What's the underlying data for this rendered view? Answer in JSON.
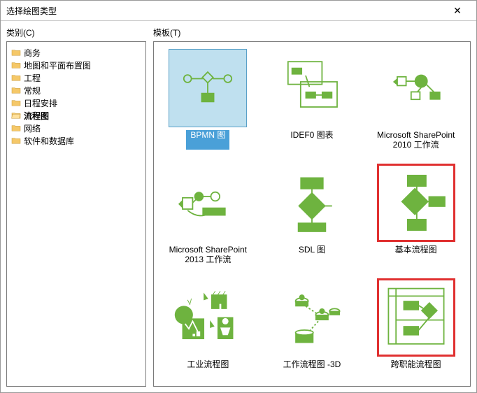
{
  "titlebar": {
    "title": "选择绘图类型",
    "close_label": "✕"
  },
  "left": {
    "label": "类别(C)",
    "items": [
      {
        "label": "商务",
        "selected": false
      },
      {
        "label": "地图和平面布置图",
        "selected": false
      },
      {
        "label": "工程",
        "selected": false
      },
      {
        "label": "常规",
        "selected": false
      },
      {
        "label": "日程安排",
        "selected": false
      },
      {
        "label": "流程图",
        "selected": true
      },
      {
        "label": "网络",
        "selected": false
      },
      {
        "label": "软件和数据库",
        "selected": false
      }
    ]
  },
  "right": {
    "label": "模板(T)",
    "templates": [
      {
        "label": "BPMN 图",
        "selected": true,
        "highlight": false
      },
      {
        "label": "IDEF0 图表",
        "selected": false,
        "highlight": false
      },
      {
        "label": "Microsoft SharePoint 2010 工作流",
        "selected": false,
        "highlight": false
      },
      {
        "label": "Microsoft SharePoint 2013 工作流",
        "selected": false,
        "highlight": false
      },
      {
        "label": "SDL 图",
        "selected": false,
        "highlight": false
      },
      {
        "label": "基本流程图",
        "selected": false,
        "highlight": true
      },
      {
        "label": "工业流程图",
        "selected": false,
        "highlight": false
      },
      {
        "label": "工作流程图 -3D",
        "selected": false,
        "highlight": false
      },
      {
        "label": "跨职能流程图",
        "selected": false,
        "highlight": true
      }
    ]
  }
}
